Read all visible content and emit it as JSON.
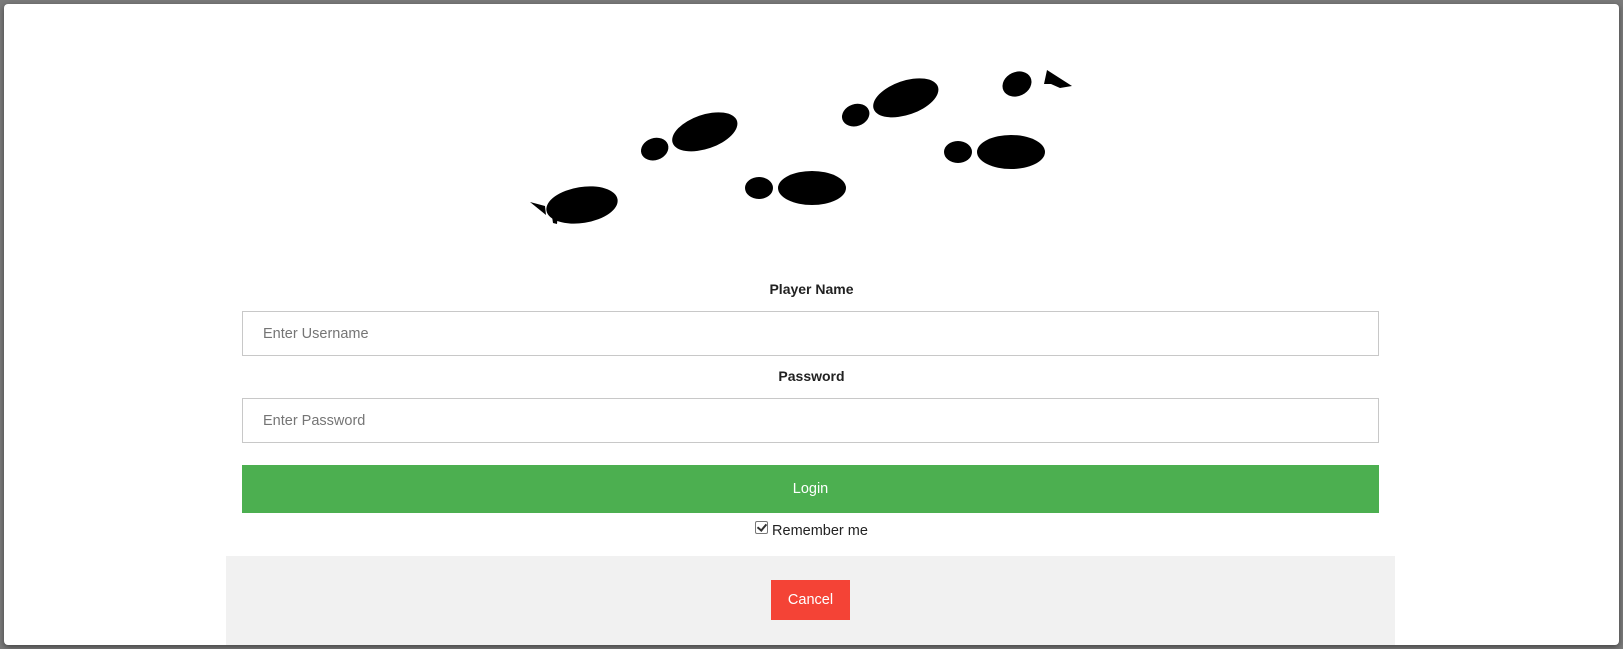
{
  "logo": {
    "icon": "footprints-icon"
  },
  "form": {
    "username_label": "Player Name",
    "username_placeholder": "Enter Username",
    "password_label": "Password",
    "password_placeholder": "Enter Password",
    "login_label": "Login",
    "remember_label": "Remember me",
    "remember_checked": true
  },
  "footer": {
    "cancel_label": "Cancel"
  },
  "colors": {
    "login_button": "#4caf50",
    "cancel_button": "#f44336",
    "footer_background": "#f1f1f1"
  }
}
